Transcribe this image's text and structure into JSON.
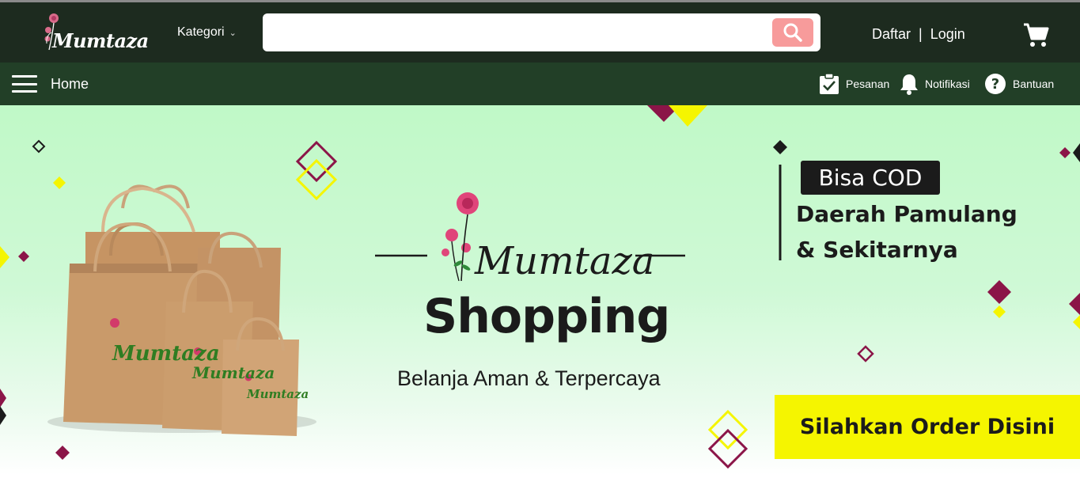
{
  "brand": {
    "logo_text": "Mumtaza"
  },
  "header": {
    "category_label": "Kategori",
    "search": {
      "placeholder": ""
    },
    "register_label": "Daftar",
    "separator": "|",
    "login_label": "Login"
  },
  "nav": {
    "home_label": "Home",
    "items": [
      {
        "label": "Pesanan",
        "icon": "clipboard-check-icon"
      },
      {
        "label": "Notifikasi",
        "icon": "bell-icon"
      },
      {
        "label": "Bantuan",
        "icon": "help-circle-icon"
      }
    ]
  },
  "banner": {
    "logo_script": "Mumtaza",
    "headline": "Shopping",
    "tagline": "Belanja Aman & Terpercaya",
    "cod_badge": "Bisa COD",
    "area_line1": "Daerah Pamulang",
    "area_line2": "& Sekitarnya",
    "cta": "Silahkan Order Disini",
    "bag_logo": "Mumtaza"
  },
  "colors": {
    "topbar": "#1d2b1f",
    "navbar": "#223f27",
    "search_button": "#f79b9b",
    "banner_bg": "#c0f9c7",
    "maroon": "#8b1548",
    "yellow": "#f5f500"
  }
}
